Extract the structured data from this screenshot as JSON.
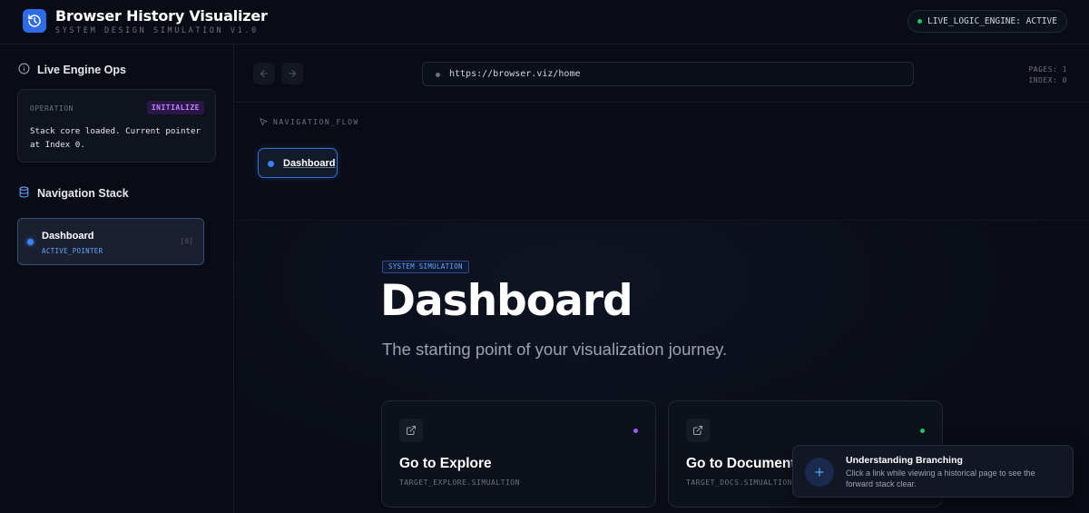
{
  "header": {
    "title": "Browser History Visualizer",
    "subtitle": "SYSTEM DESIGN SIMULATION V1.0",
    "status": "LIVE_LOGIC_ENGINE: ACTIVE"
  },
  "sidebar": {
    "ops_title": "Live Engine Ops",
    "ops_card": {
      "label": "OPERATION",
      "badge": "INITIALIZE",
      "text": "Stack core loaded. Current pointer at Index 0."
    },
    "stack_title": "Navigation Stack",
    "stack_items": [
      {
        "name": "Dashboard",
        "pointer": "ACTIVE_POINTER",
        "index": "[0]"
      }
    ]
  },
  "browser": {
    "url": "https://browser.viz/home",
    "pages_label": "PAGES: 1",
    "index_label": "INDEX: 0"
  },
  "flow": {
    "label": "NAVIGATION_FLOW",
    "nodes": [
      {
        "label": "Dashboard"
      }
    ]
  },
  "content": {
    "badge": "SYSTEM SIMULATION",
    "heading": "Dashboard",
    "description": "The starting point of your visualization journey.",
    "cards": [
      {
        "title": "Go to Explore",
        "target": "TARGET_EXPLORE.SIMUALTION",
        "dot_color": "#a855f7"
      },
      {
        "title": "Go to Documentation",
        "target": "TARGET_DOCS.SIMUALTION",
        "dot_color": "#22c55e"
      }
    ]
  },
  "toast": {
    "title": "Understanding Branching",
    "text": "Click a link while viewing a historical page to see the forward stack clear."
  },
  "colors": {
    "accent": "#2e6be6",
    "badge_purple": "#c084fc",
    "status_green": "#22c55e"
  }
}
